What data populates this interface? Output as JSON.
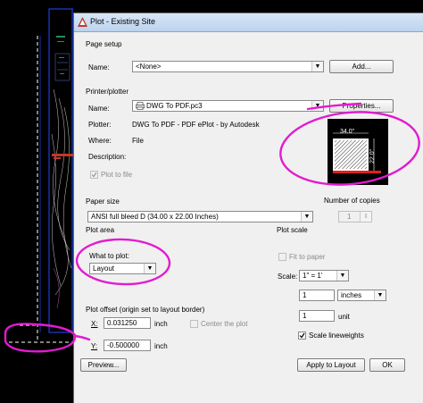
{
  "dialog": {
    "title": "Plot - Existing Site",
    "page_setup": {
      "section_label": "Page setup",
      "name_label": "Name:",
      "name_value": "<None>",
      "add_button": "Add..."
    },
    "printer": {
      "section_label": "Printer/plotter",
      "name_label": "Name:",
      "name_value": "DWG To PDF.pc3",
      "properties_button": "Properties...",
      "plotter_label": "Plotter:",
      "plotter_value": "DWG To PDF - PDF ePlot - by Autodesk",
      "where_label": "Where:",
      "where_value": "File",
      "description_label": "Description:",
      "plot_to_file_label": "Plot to file",
      "preview_width": "34.0\"",
      "preview_height": "22.0\""
    },
    "paper_size": {
      "section_label": "Paper size",
      "value": "ANSI full bleed D (34.00 x 22.00 Inches)"
    },
    "copies": {
      "section_label": "Number of copies",
      "value": "1"
    },
    "plot_area": {
      "section_label": "Plot area",
      "what_label": "What to plot:",
      "what_value": "Layout"
    },
    "plot_offset": {
      "section_label": "Plot offset (origin set to layout border)",
      "x_label": "X:",
      "x_value": "0.031250",
      "x_unit": "inch",
      "y_label": "Y:",
      "y_value": "-0.500000",
      "y_unit": "inch",
      "center_label": "Center the plot"
    },
    "plot_scale": {
      "section_label": "Plot scale",
      "fit_label": "Fit to paper",
      "scale_label": "Scale:",
      "scale_value": "1\" = 1'",
      "num_value": "1",
      "num_unit": "inches",
      "den_value": "1",
      "den_unit": "unit",
      "lineweights_label": "Scale lineweights"
    },
    "footer": {
      "preview_button": "Preview...",
      "apply_button": "Apply to Layout",
      "ok_button": "OK"
    }
  },
  "colors": {
    "annotation": "#e21bd0",
    "cad_background": "#000000",
    "cad_lines": "#1c3fd6"
  }
}
